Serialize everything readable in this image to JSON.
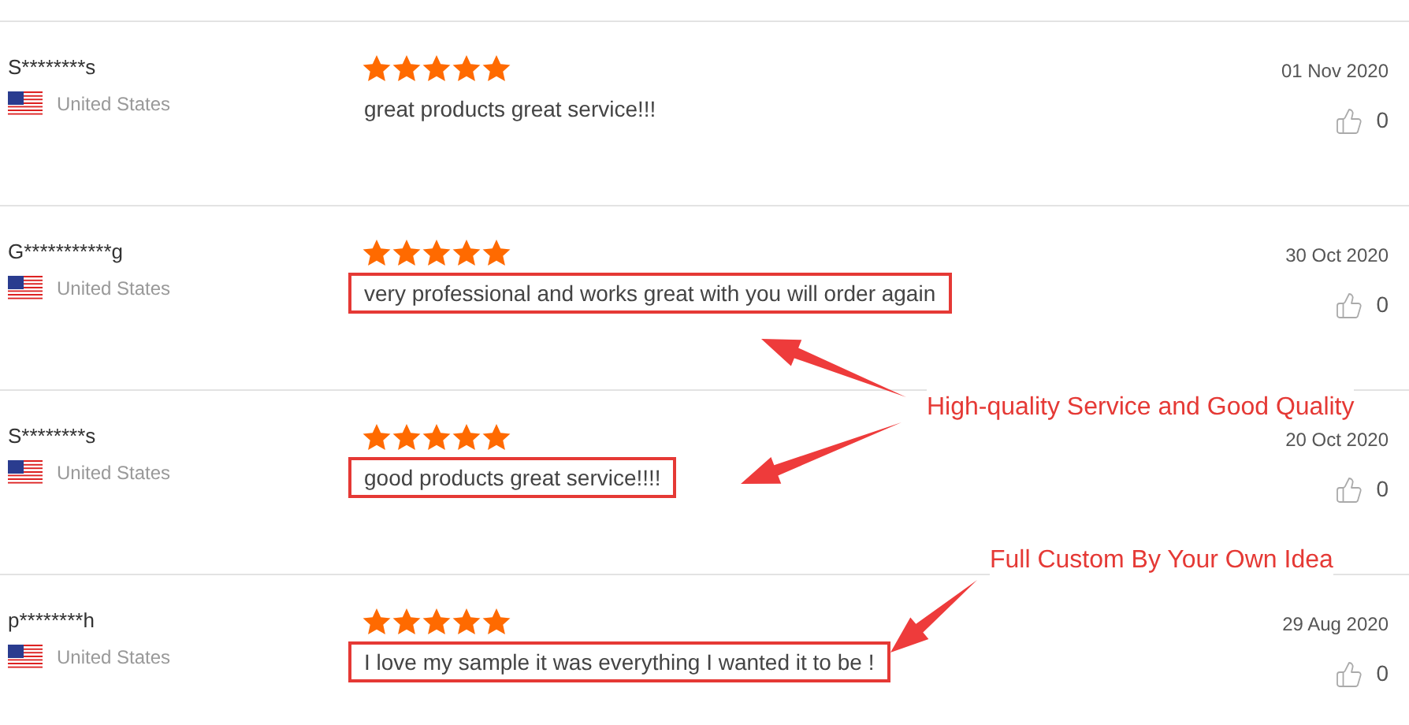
{
  "reviews": [
    {
      "name": "S********s",
      "country": "United States",
      "stars": 5,
      "comment": "great products great service!!!",
      "highlighted": false,
      "date": "01 Nov 2020",
      "likes": "0"
    },
    {
      "name": "G***********g",
      "country": "United States",
      "stars": 5,
      "comment": "very professional and works great with you will order again",
      "highlighted": true,
      "date": "30 Oct 2020",
      "likes": "0"
    },
    {
      "name": "S********s",
      "country": "United States",
      "stars": 5,
      "comment": "good products great service!!!!",
      "highlighted": true,
      "date": "20 Oct 2020",
      "likes": "0"
    },
    {
      "name": "p********h",
      "country": "United States",
      "stars": 5,
      "comment": "I love my sample it was everything I wanted it to be !",
      "highlighted": true,
      "date": "29 Aug 2020",
      "likes": "0"
    }
  ],
  "annotations": [
    {
      "text": "High-quality Service and Good Quality"
    },
    {
      "text": "Full Custom By Your Own Idea"
    }
  ]
}
